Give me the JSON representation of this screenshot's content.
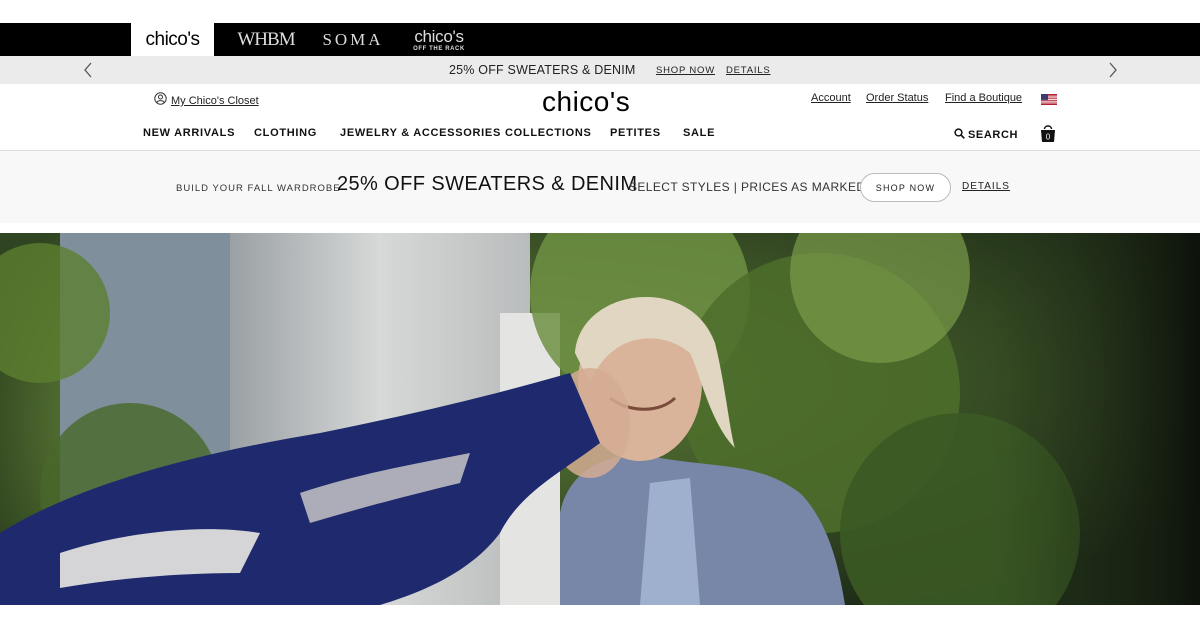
{
  "brands": [
    {
      "name": "chico's",
      "active": true
    },
    {
      "name": "WHBM",
      "active": false
    },
    {
      "name": "SOMA",
      "active": false
    },
    {
      "name": "chico's",
      "subtitle": "OFF THE RACK",
      "active": false
    }
  ],
  "promo_strip": {
    "text": "25% OFF SWEATERS & DENIM",
    "shop_now": "SHOP NOW",
    "details": "DETAILS",
    "prev_icon": "chevron-left-icon",
    "next_icon": "chevron-right-icon"
  },
  "header": {
    "closet_label": "My Chico's Closet",
    "logo": "chico's",
    "account": "Account",
    "order_status": "Order Status",
    "find_boutique": "Find a Boutique",
    "flag_icon": "us-flag-icon"
  },
  "nav": {
    "items": [
      "NEW ARRIVALS",
      "CLOTHING",
      "JEWELRY & ACCESSORIES",
      "COLLECTIONS",
      "PETITES",
      "SALE"
    ],
    "search_label": "SEARCH",
    "bag_count": "0"
  },
  "banner": {
    "pre": "BUILD YOUR FALL WARDROBE",
    "headline": "25% OFF SWEATERS & DENIM",
    "post": "SELECT STYLES | PRICES AS MARKED",
    "shop_now": "SHOP NOW",
    "details": "DETAILS"
  },
  "colors": {
    "brand_bar": "#000000",
    "promo_strip": "#ebebeb",
    "banner_bg": "#f8f8f8",
    "garment": "#1f2a6e"
  }
}
